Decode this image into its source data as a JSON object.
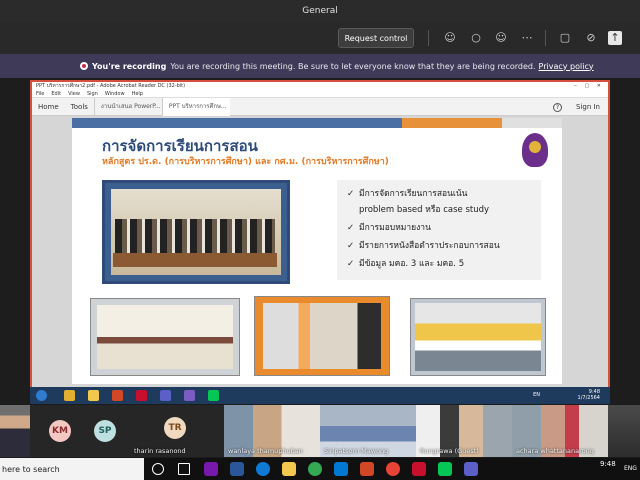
{
  "teams": {
    "meeting_title": "General",
    "request_control_label": "Request control"
  },
  "recording_banner": {
    "title": "You're recording",
    "message": "You are recording this meeting. Be sure to let everyone know that they are being recorded.",
    "link_text": "Privacy policy"
  },
  "acrobat": {
    "window_title": "PPT บริหารการศึกษา2.pdf - Adobe Acrobat Reader DC (32-bit)",
    "menu": [
      "File",
      "Edit",
      "View",
      "Sign",
      "Window",
      "Help"
    ],
    "tabs": {
      "home": "Home",
      "tools": "Tools"
    },
    "documents": [
      {
        "title": "งานนำเสนอ PowerP...",
        "active": false
      },
      {
        "title": "PPT บริหารการศึกษ...",
        "active": true
      }
    ],
    "sign_in_label": "Sign In",
    "slide": {
      "title": "การจัดการเรียนการสอน",
      "subtitle": "หลักสูตร ปร.ด. (การบริหารการศึกษา) และ กศ.ม. (การบริหารการศึกษา)",
      "bullets": [
        "มีการจัดการเรียนการสอนเน้น",
        "problem based หรือ case study",
        "มีการมอบหมายงาน",
        "มีรายการหนังสือตำราประกอบการสอน",
        "มีข้อมูล มคอ. 3 และ มคอ. 5"
      ]
    },
    "inner_clock": {
      "time": "9:48",
      "date": "1/7/2564"
    },
    "inner_lang": "EN"
  },
  "participants": [
    {
      "initials": "KM",
      "bg": "#f4c7c3",
      "fg": "#8a2e2e"
    },
    {
      "initials": "SP",
      "bg": "#bfe0e0",
      "fg": "#1f5f5f"
    },
    {
      "initials": "TR",
      "bg": "#f1d9c0",
      "fg": "#7a4a1f",
      "name": "tharin rasanond"
    },
    {
      "name": "wanlaya thamuphuban"
    },
    {
      "name": "Siripatsorn Mawong"
    },
    {
      "name": "Rungrawa (Guest)"
    },
    {
      "name": "achara whattananarong"
    }
  ],
  "taskbar": {
    "search_placeholder": "here to search",
    "time": "9:48",
    "lang": "ENG"
  }
}
